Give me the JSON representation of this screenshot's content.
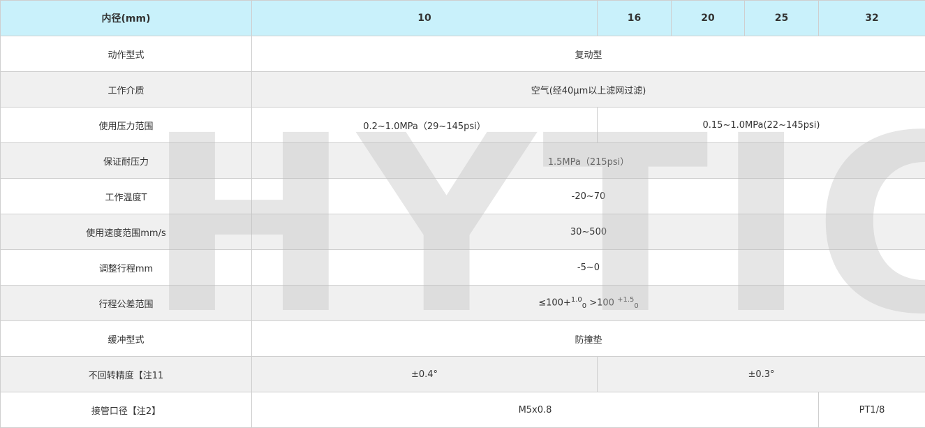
{
  "watermark": "HYTIC",
  "header": {
    "label": "内径(mm)",
    "bores": [
      "10",
      "16",
      "20",
      "25",
      "32"
    ]
  },
  "rows": {
    "action": {
      "label": "动作型式",
      "value": "复动型"
    },
    "medium": {
      "label": "工作介质",
      "value": "空气(经40μm以上滤网过滤)"
    },
    "pressure": {
      "label": "使用压力范围",
      "value_a": "0.2~1.0MPa（29~145psi）",
      "value_b": "0.15~1.0MPa(22~145psi)"
    },
    "proof": {
      "label": "保证耐压力",
      "value": "1.5MPa（215psi）"
    },
    "temp": {
      "label": "工作温度T",
      "value": "-20~70"
    },
    "speed": {
      "label": "使用速度范围mm/s",
      "value": "30~500"
    },
    "stroke_adj": {
      "label": "调整行程mm",
      "value": "-5~0"
    },
    "tolerance": {
      "label": "行程公差范围",
      "p1": "≤100+",
      "sup1": "1.0",
      "sub1": "0",
      "p2": " >100 ",
      "sup2": "+1.5",
      "sub2": "0"
    },
    "cushion": {
      "label": "缓冲型式",
      "value": "防撞垫"
    },
    "rotation": {
      "label": "不回转精度【注11",
      "value_a": "±0.4°",
      "value_b": "±0.3°"
    },
    "port": {
      "label": "接管口径【注2】",
      "value_a": "M5x0.8",
      "value_b": "PT1/8"
    }
  }
}
